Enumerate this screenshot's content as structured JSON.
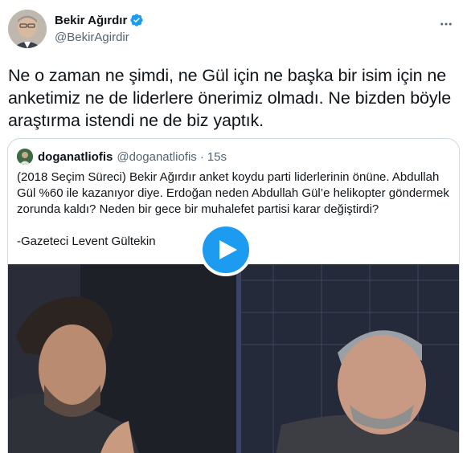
{
  "author": {
    "display_name": "Bekir Ağırdır",
    "handle": "@BekirAgirdir",
    "verified": true
  },
  "tweet": {
    "text": "Ne o zaman ne şimdi, ne Gül için ne başka bir isim için ne anketimiz ne de liderlere önerimiz olmadı. Ne bizden böyle araştırma istendi ne de biz yaptık."
  },
  "quoted_tweet": {
    "display_name": "doganatliofis",
    "handle": "@doganatliofis",
    "separator": "·",
    "time": "15s",
    "text": "(2018 Seçim Süreci) Bekir Ağırdır anket koydu parti liderlerinin önüne. Abdullah Gül %60 ile kazanıyor diye. Erdoğan neden Abdullah Gül’e helikopter göndermek zorunda kaldı? Neden bir gece bir muhalefet partisi karar değiştirdi?\n\n-Gazeteci Levent Gültekin"
  },
  "colors": {
    "accent": "#1d9bf0",
    "text_primary": "#0f1419",
    "text_secondary": "#536471",
    "border": "#cfd9de"
  },
  "icons": [
    "verified-badge-icon",
    "more-options-icon",
    "play-icon"
  ]
}
